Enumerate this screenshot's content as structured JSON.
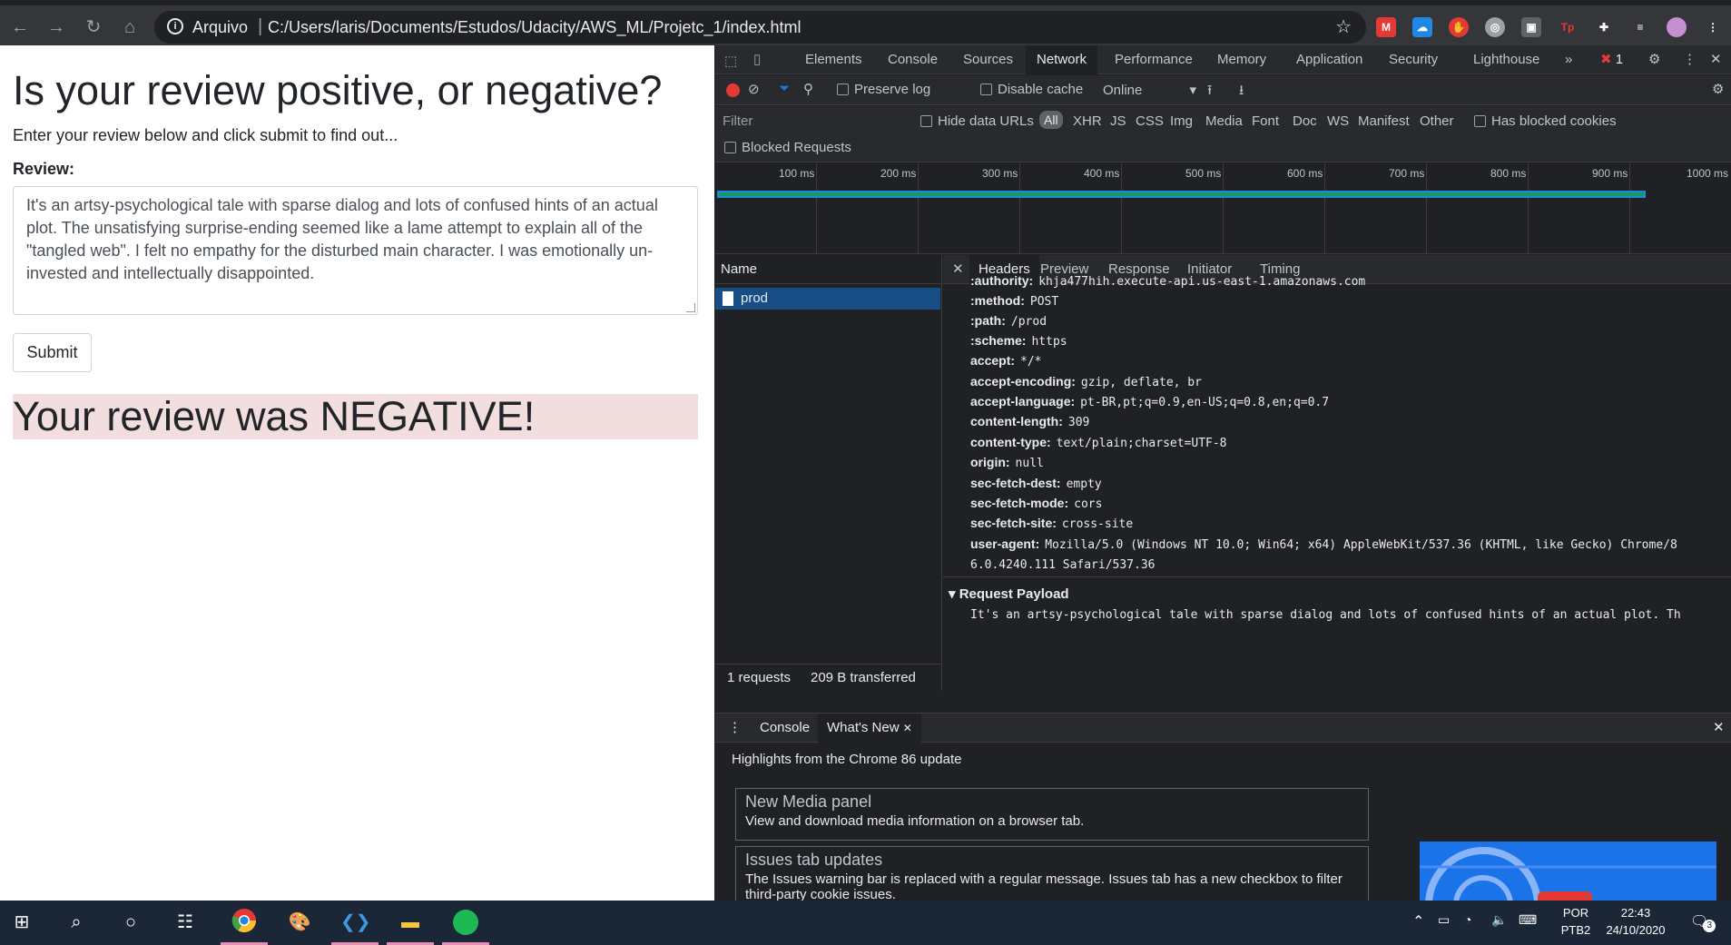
{
  "browser": {
    "scheme_label": "Arquivo",
    "url": "C:/Users/laris/Documents/Estudos/Udacity/AWS_ML/Projetc_1/index.html"
  },
  "page": {
    "title": "Is your review positive, or negative?",
    "subtitle": "Enter your review below and click submit to find out...",
    "review_label": "Review:",
    "review_text": "It's an artsy-psychological tale with sparse dialog and lots of confused hints of an actual plot. The unsatisfying surprise-ending seemed like a lame attempt to explain all of the \"tangled web\". I felt no empathy for the disturbed main character. I was emotionally un-invested and intellectually disappointed.",
    "submit_label": "Submit",
    "result": "Your review was NEGATIVE!"
  },
  "devtools": {
    "tabs": [
      "Elements",
      "Console",
      "Sources",
      "Network",
      "Performance",
      "Memory",
      "Application",
      "Security",
      "Lighthouse"
    ],
    "more": "»",
    "error_count": "1",
    "toolbar": {
      "preserve_log": "Preserve log",
      "disable_cache": "Disable cache",
      "throttle": "Online"
    },
    "filter": {
      "placeholder": "Filter",
      "hide_data_urls": "Hide data URLs",
      "types": [
        "All",
        "XHR",
        "JS",
        "CSS",
        "Img",
        "Media",
        "Font",
        "Doc",
        "WS",
        "Manifest",
        "Other"
      ],
      "has_blocked_cookies": "Has blocked cookies",
      "blocked_requests": "Blocked Requests"
    },
    "timeline_ticks": [
      "100 ms",
      "200 ms",
      "300 ms",
      "400 ms",
      "500 ms",
      "600 ms",
      "700 ms",
      "800 ms",
      "900 ms",
      "1000 ms"
    ],
    "name_header": "Name",
    "request_name": "prod",
    "status": {
      "requests": "1 requests",
      "transferred": "209 B transferred"
    },
    "detail_tabs": [
      "Headers",
      "Preview",
      "Response",
      "Initiator",
      "Timing"
    ],
    "headers": [
      {
        "k": ":authority:",
        "v": "khja477hih.execute-api.us-east-1.amazonaws.com"
      },
      {
        "k": ":method:",
        "v": "POST"
      },
      {
        "k": ":path:",
        "v": "/prod"
      },
      {
        "k": ":scheme:",
        "v": "https"
      },
      {
        "k": "accept:",
        "v": "*/*"
      },
      {
        "k": "accept-encoding:",
        "v": "gzip, deflate, br"
      },
      {
        "k": "accept-language:",
        "v": "pt-BR,pt;q=0.9,en-US;q=0.8,en;q=0.7"
      },
      {
        "k": "content-length:",
        "v": "309"
      },
      {
        "k": "content-type:",
        "v": "text/plain;charset=UTF-8"
      },
      {
        "k": "origin:",
        "v": "null"
      },
      {
        "k": "sec-fetch-dest:",
        "v": "empty"
      },
      {
        "k": "sec-fetch-mode:",
        "v": "cors"
      },
      {
        "k": "sec-fetch-site:",
        "v": "cross-site"
      },
      {
        "k": "user-agent:",
        "v": "Mozilla/5.0 (Windows NT 10.0; Win64; x64) AppleWebKit/537.36 (KHTML, like Gecko) Chrome/8"
      },
      {
        "k": "",
        "v": "6.0.4240.111 Safari/537.36"
      }
    ],
    "payload_title": "Request Payload",
    "payload_preview": "It's an artsy-psychological tale with sparse dialog and lots of confused hints of an actual plot. Th",
    "drawer": {
      "tabs": [
        "Console",
        "What's New"
      ],
      "highlights": "Highlights from the Chrome 86 update",
      "cards": [
        {
          "title": "New Media panel",
          "desc": "View and download media information on a browser tab."
        },
        {
          "title": "Issues tab updates",
          "desc": "The Issues warning bar is replaced with a regular message. Issues tab has a new checkbox to filter third-party cookie issues."
        }
      ]
    }
  },
  "taskbar": {
    "lang": "POR",
    "layout": "PTB2",
    "time": "22:43",
    "date": "24/10/2020",
    "notifications": "3"
  }
}
